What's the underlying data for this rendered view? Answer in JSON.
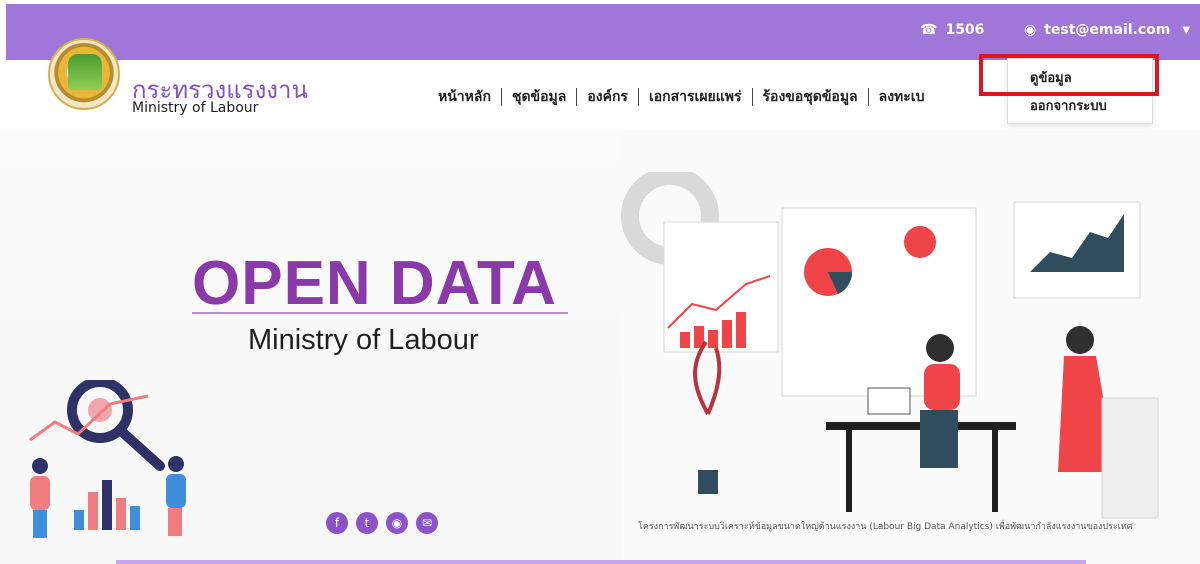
{
  "topbar": {
    "phone": "1506",
    "user_email": "test@email.com"
  },
  "logo": {
    "thai": "กระทรวงแรงงาน",
    "english": "Ministry of Labour"
  },
  "nav": {
    "items": [
      {
        "label": "หน้าหลัก"
      },
      {
        "label": "ชุดข้อมูล"
      },
      {
        "label": "องค์กร"
      },
      {
        "label": "เอกสารเผยแพร่"
      },
      {
        "label": "ร้องขอชุดข้อมูล"
      },
      {
        "label": "ลงทะเบ"
      }
    ]
  },
  "dropdown": {
    "items": [
      "ดูข้อมูล",
      "ออกจากระบบ"
    ]
  },
  "hero": {
    "title": "OPEN DATA",
    "subtitle": "Ministry of Labour",
    "caption": "โครงการพัฒนาระบบวิเคราะห์ข้อมูลขนาดใหญ่ด้านแรงงาน (Labour Big Data Analytics) เพื่อพัฒนากำลังแรงงานของประเทศ"
  },
  "social": {
    "facebook": "f",
    "twitter": "t",
    "rss": "◉",
    "mail": "✉"
  }
}
